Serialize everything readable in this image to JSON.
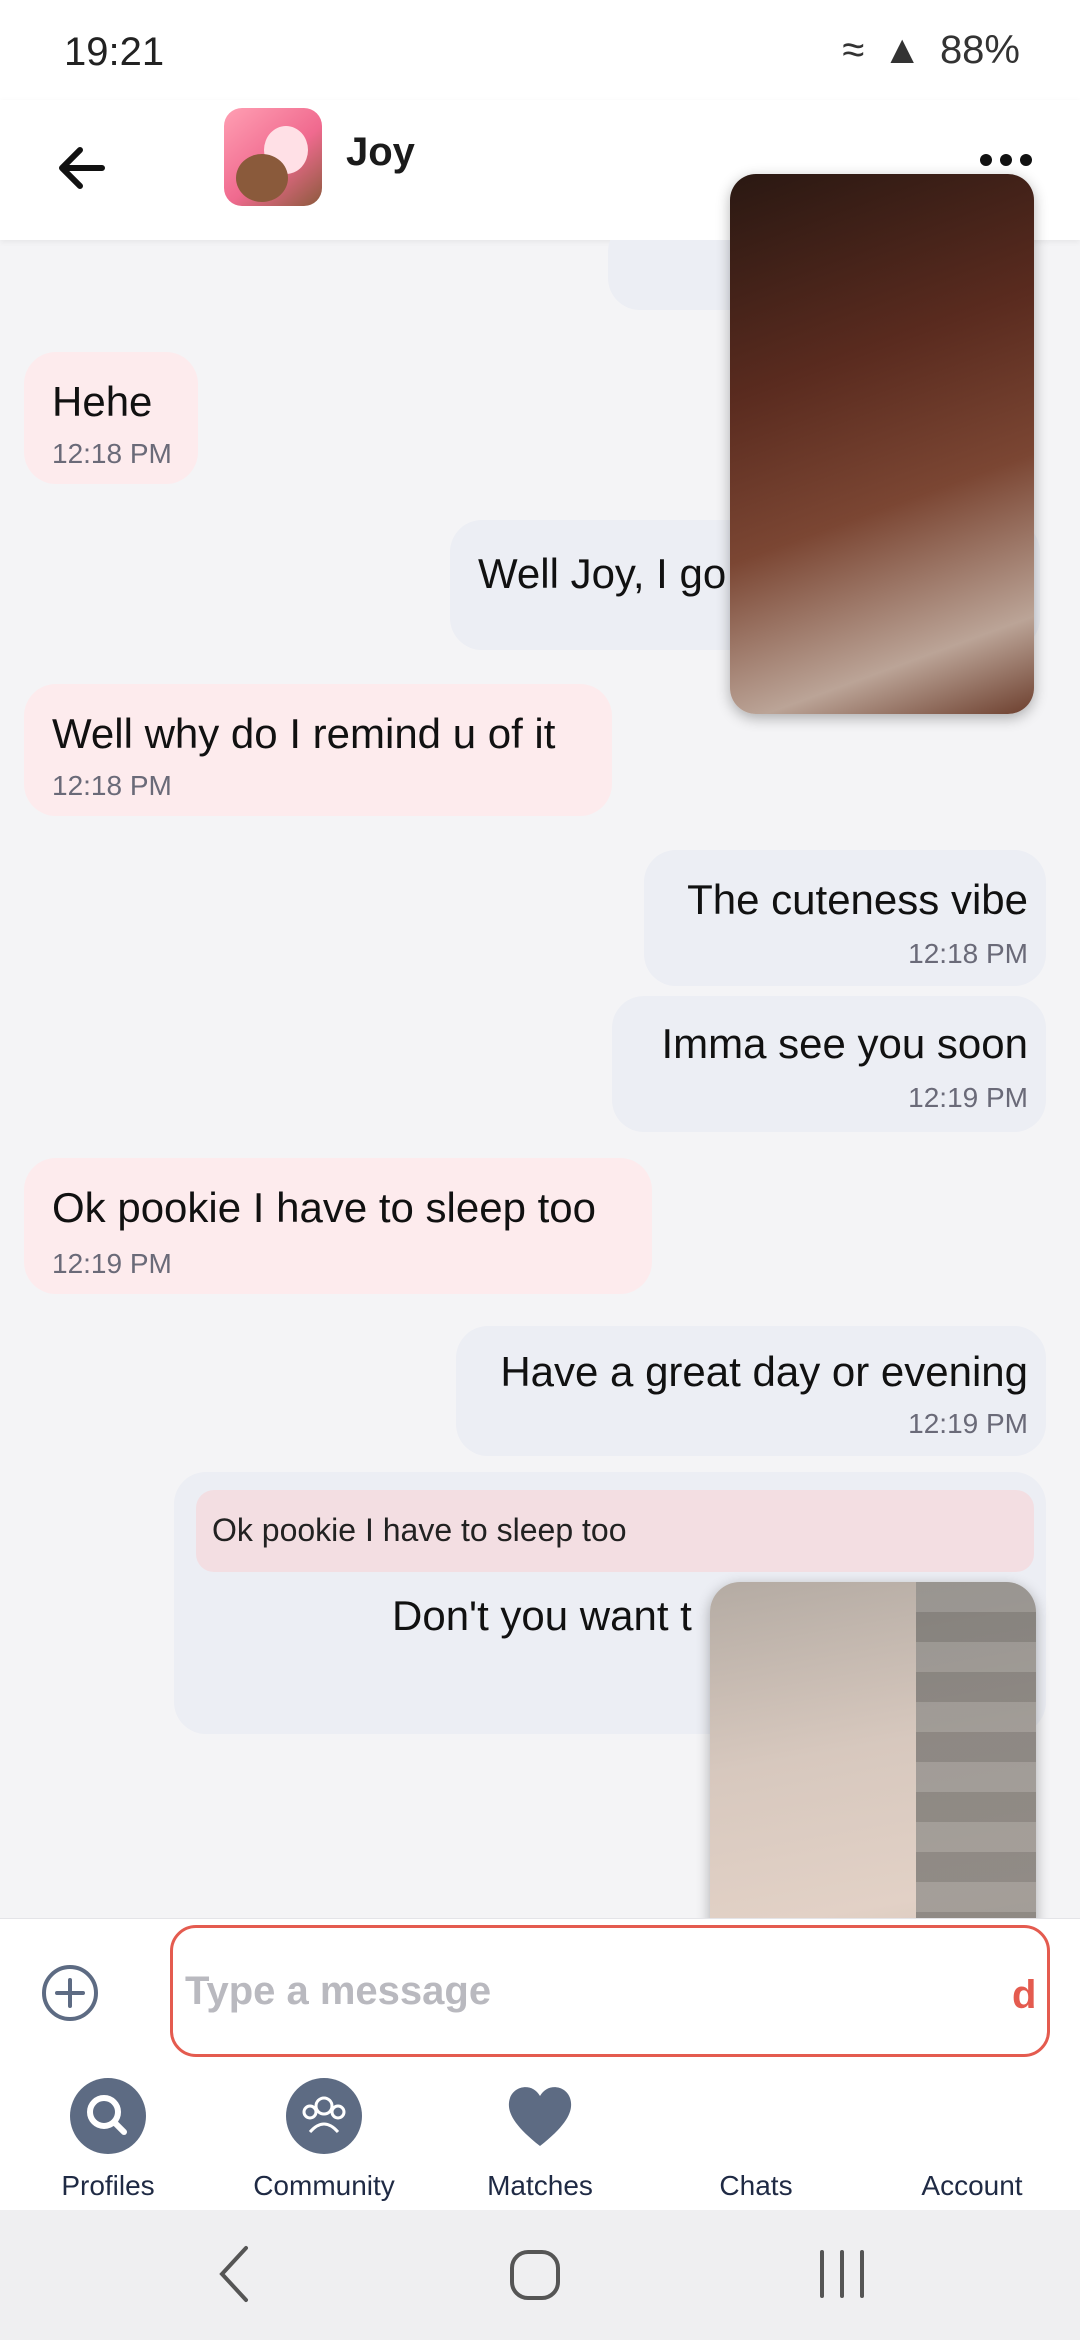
{
  "status_bar": {
    "time": "19:21",
    "battery": "88%"
  },
  "header": {
    "contact_name": "Joy"
  },
  "messages": [
    {
      "direction": "incoming",
      "text": "Hehe",
      "time": "12:18 PM"
    },
    {
      "direction": "outgoing",
      "text": "Well Joy, I go",
      "time": ""
    },
    {
      "direction": "incoming",
      "text": "Well why do I remind u of it",
      "time": "12:18 PM"
    },
    {
      "direction": "outgoing",
      "text": "The cuteness vibe",
      "time": "12:18 PM"
    },
    {
      "direction": "outgoing",
      "text": "Imma see you soon",
      "time": "12:19 PM"
    },
    {
      "direction": "incoming",
      "text": "Ok pookie I have to sleep too",
      "time": "12:19 PM"
    },
    {
      "direction": "outgoing",
      "text": "Have a great day or evening",
      "time": "12:19 PM"
    },
    {
      "direction": "outgoing",
      "quoted_text": "Ok pookie I have to sleep too",
      "text": "Don't you want t",
      "time": ""
    }
  ],
  "composer": {
    "placeholder": "Type a message"
  },
  "bottom_nav": [
    {
      "label": "Profiles",
      "icon": "search-icon"
    },
    {
      "label": "Community",
      "icon": "group-icon"
    },
    {
      "label": "Matches",
      "icon": "heart-icon"
    },
    {
      "label": "Chats",
      "icon": "chat-icon"
    },
    {
      "label": "Account",
      "icon": "account-icon"
    }
  ],
  "colors": {
    "accent": "#e45b4f",
    "incoming_bubble": "#fdebed",
    "outgoing_bubble": "#eceef4",
    "nav_icon": "#5d6b83"
  }
}
